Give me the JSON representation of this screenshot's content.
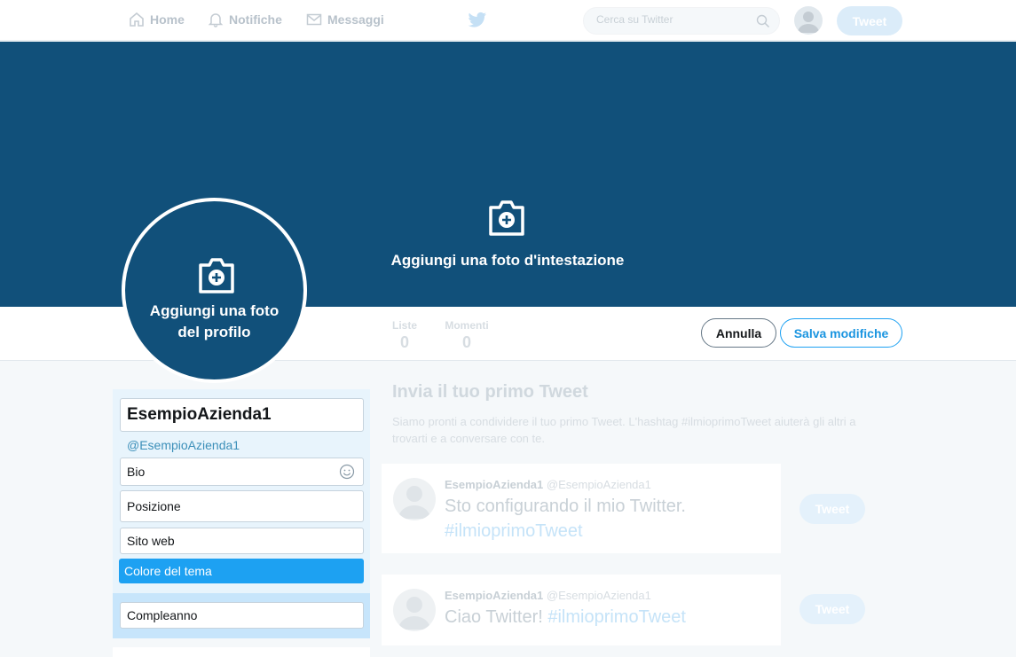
{
  "nav": {
    "home": "Home",
    "notifications": "Notifiche",
    "messages": "Messaggi",
    "search_placeholder": "Cerca su Twitter",
    "tweet_button": "Tweet"
  },
  "header": {
    "add_header_photo": "Aggiungi una foto d'intestazione"
  },
  "avatar": {
    "add_profile_photo_line1": "Aggiungi una foto",
    "add_profile_photo_line2": "del profilo"
  },
  "stats": [
    {
      "label": "Liste",
      "value": "0"
    },
    {
      "label": "Momenti",
      "value": "0"
    }
  ],
  "actions": {
    "cancel": "Annulla",
    "save": "Salva modifiche"
  },
  "profile_form": {
    "name": "EsempioAzienda1",
    "handle": "@EsempioAzienda1",
    "bio_placeholder": "Bio",
    "location_placeholder": "Posizione",
    "website_placeholder": "Sito web",
    "theme_color": "Colore del tema",
    "birthday": "Compleanno"
  },
  "timeline": {
    "title": "Invia il tuo primo Tweet",
    "description": "Siamo pronti a condividere il tuo primo Tweet. L'hashtag #ilmioprimoTweet aiuterà gli altri a trovarti e a conversare con te.",
    "tweets": [
      {
        "name": "EsempioAzienda1",
        "handle": "@EsempioAzienda1",
        "text": "Sto configurando il mio Twitter.",
        "hashtag": "#ilmioprimoTweet",
        "button": "Tweet"
      },
      {
        "name": "EsempioAzienda1",
        "handle": "@EsempioAzienda1",
        "text": "Ciao Twitter!",
        "hashtag": "#ilmioprimoTweet",
        "button": "Tweet"
      }
    ]
  },
  "colors": {
    "header_bg": "#11507a",
    "accent": "#1da1f2"
  }
}
